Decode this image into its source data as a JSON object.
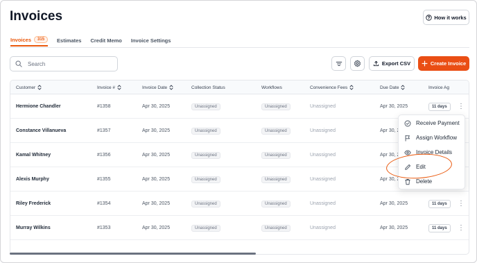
{
  "page": {
    "title": "Invoices"
  },
  "header": {
    "how_it_works_label": "How it works",
    "how_it_works_icon": "help-circle-icon"
  },
  "tabs": [
    {
      "label": "Invoices",
      "badge": "315",
      "active": true
    },
    {
      "label": "Estimates"
    },
    {
      "label": "Credit Memo"
    },
    {
      "label": "Invoice Settings"
    }
  ],
  "toolbar": {
    "search_placeholder": "Search",
    "export_label": "Export CSV",
    "create_label": "Create Invoice",
    "accent_color": "#ea4e14"
  },
  "table": {
    "columns": [
      {
        "label": "Customer",
        "sortable": true
      },
      {
        "label": "Invoice #",
        "sortable": true
      },
      {
        "label": "Invoice Date",
        "sortable": true
      },
      {
        "label": "Collection Status",
        "sortable": false
      },
      {
        "label": "Workflows",
        "sortable": false
      },
      {
        "label": "Convenience Fees",
        "sortable": true
      },
      {
        "label": "Due Date",
        "sortable": true
      },
      {
        "label": "Invoice Ag",
        "sortable": false
      }
    ],
    "rows": [
      {
        "customer": "Hermione Chandler",
        "invoice": "#1358",
        "date": "Apr 30, 2025",
        "collection": "Unassigned",
        "workflow": "Unassigned",
        "fees": "Unassigned",
        "due": "Apr 30, 2025",
        "age": "11 days"
      },
      {
        "customer": "Constance Villanueva",
        "invoice": "#1357",
        "date": "Apr 30, 2025",
        "collection": "Unassigned",
        "workflow": "Unassigned",
        "fees": "Unassigned",
        "due": "Apr 30, 2025",
        "age": ""
      },
      {
        "customer": "Kamal Whitney",
        "invoice": "#1356",
        "date": "Apr 30, 2025",
        "collection": "Unassigned",
        "workflow": "Unassigned",
        "fees": "Unassigned",
        "due": "Apr 30, 2025",
        "age": ""
      },
      {
        "customer": "Alexis Murphy",
        "invoice": "#1355",
        "date": "Apr 30, 2025",
        "collection": "Unassigned",
        "workflow": "Unassigned",
        "fees": "Unassigned",
        "due": "Apr 30, 2025",
        "age": ""
      },
      {
        "customer": "Riley Frederick",
        "invoice": "#1354",
        "date": "Apr 30, 2025",
        "collection": "Unassigned",
        "workflow": "Unassigned",
        "fees": "Unassigned",
        "due": "Apr 30, 2025",
        "age": "11 days"
      },
      {
        "customer": "Murray Wilkins",
        "invoice": "#1353",
        "date": "Apr 30, 2025",
        "collection": "Unassigned",
        "workflow": "Unassigned",
        "fees": "Unassigned",
        "due": "Apr 30, 2025",
        "age": "11 days"
      }
    ]
  },
  "row_menu": {
    "items": [
      {
        "label": "Receive Payment",
        "icon": "check-circle-icon"
      },
      {
        "label": "Assign Workflow",
        "icon": "flag-icon"
      },
      {
        "label": "Invoice Details",
        "icon": "eye-icon"
      },
      {
        "label": "Edit",
        "icon": "pencil-icon",
        "highlighted": true
      },
      {
        "label": "Delete",
        "icon": "trash-icon"
      }
    ],
    "highlight_color": "#ea580c"
  }
}
